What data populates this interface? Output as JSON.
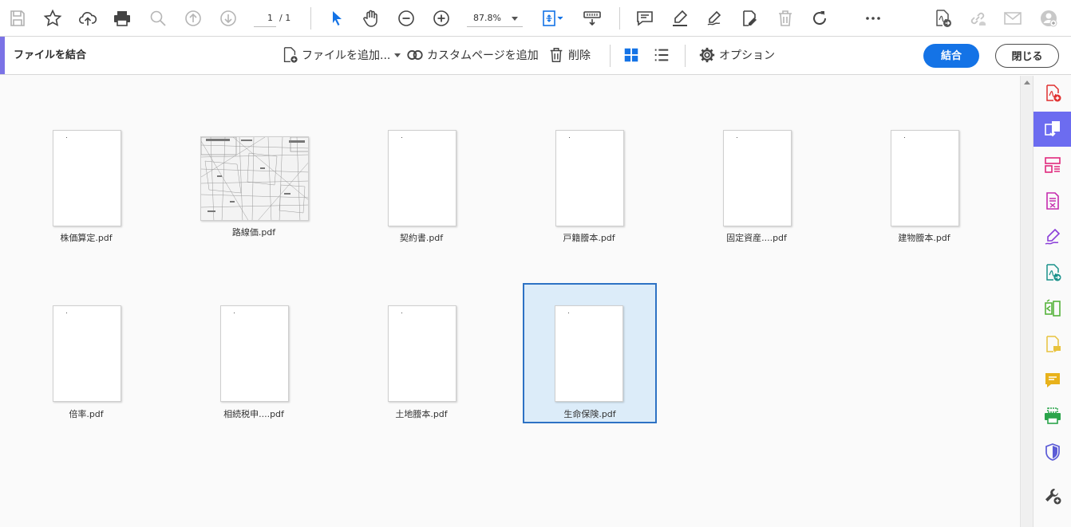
{
  "toolbar": {
    "page_current": "1",
    "page_total": "/ 1",
    "zoom": "87.8%",
    "icons": [
      "save-icon",
      "star-icon",
      "cloud-upload-icon",
      "print-icon",
      "zoom-search-icon",
      "page-up-icon",
      "page-down-icon",
      "select-cursor-icon",
      "hand-icon",
      "zoom-out-icon",
      "zoom-in-icon",
      "fit-page-icon",
      "scroll-mode-icon",
      "comment-icon",
      "highlight-icon",
      "sign-icon",
      "edit-pdf-icon",
      "trash-icon",
      "rotate-icon",
      "more-icon",
      "share-file-icon",
      "link-icon",
      "email-icon",
      "account-icon"
    ]
  },
  "combine": {
    "title": "ファイルを結合",
    "add_files": "ファイルを追加...",
    "add_custom_page": "カスタムページを追加",
    "delete": "削除",
    "options": "オプション",
    "combine_button": "結合",
    "close_button": "閉じる"
  },
  "files": [
    {
      "name": "株価算定.pdf",
      "orientation": "portrait",
      "selected": false
    },
    {
      "name": "路線価.pdf",
      "orientation": "landscape",
      "selected": false
    },
    {
      "name": "契約書.pdf",
      "orientation": "portrait",
      "selected": false
    },
    {
      "name": "戸籍謄本.pdf",
      "orientation": "portrait",
      "selected": false
    },
    {
      "name": "固定資産....pdf",
      "orientation": "portrait",
      "selected": false
    },
    {
      "name": "建物謄本.pdf",
      "orientation": "portrait",
      "selected": false
    },
    {
      "name": "倍率.pdf",
      "orientation": "portrait",
      "selected": false
    },
    {
      "name": "相続税申....pdf",
      "orientation": "portrait",
      "selected": false
    },
    {
      "name": "土地謄本.pdf",
      "orientation": "portrait",
      "selected": false
    },
    {
      "name": "生命保険.pdf",
      "orientation": "portrait",
      "selected": true
    }
  ],
  "right_panel": {
    "tools": [
      {
        "icon": "create-pdf-icon",
        "color": "#e0302f"
      },
      {
        "icon": "combine-files-icon",
        "color": "#ffffff",
        "active": true
      },
      {
        "icon": "organize-pages-icon",
        "color": "#e0287c"
      },
      {
        "icon": "export-pdf-icon",
        "color": "#c62cae"
      },
      {
        "icon": "fill-sign-icon",
        "color": "#8a3dd8"
      },
      {
        "icon": "send-for-review-icon",
        "color": "#19918a"
      },
      {
        "icon": "compare-files-icon",
        "color": "#56b33b"
      },
      {
        "icon": "add-comment-file-icon",
        "color": "#e8c23c"
      },
      {
        "icon": "comment-icon",
        "color": "#e8b21b"
      },
      {
        "icon": "print-production-icon",
        "color": "#2aa44a"
      },
      {
        "icon": "protect-icon",
        "color": "#5b5bd6"
      },
      {
        "icon": "more-tools-icon",
        "color": "#444444"
      }
    ]
  },
  "colors": {
    "accent": "#1473e6",
    "panel_accent": "#7b73e6",
    "selection_bg": "#dcecf9",
    "selection_border": "#2d72c4"
  }
}
